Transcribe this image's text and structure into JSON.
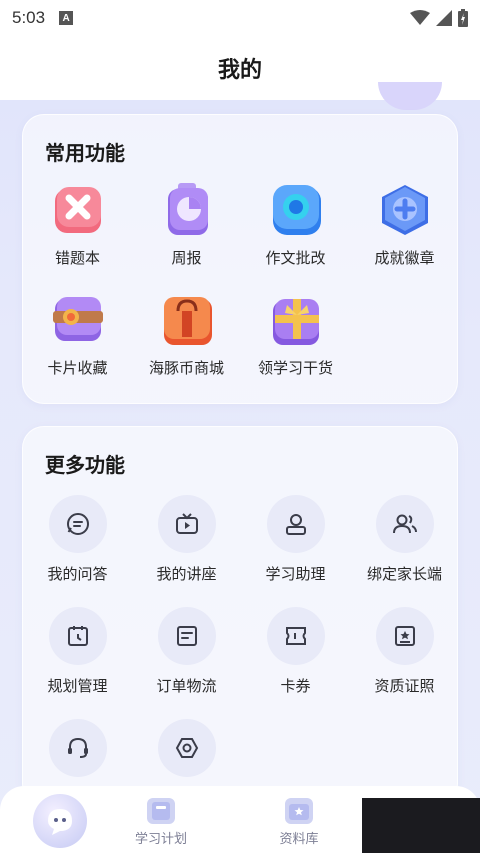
{
  "status": {
    "time": "5:03",
    "notif_letter": "A"
  },
  "header": {
    "title": "我的"
  },
  "common": {
    "title": "常用功能",
    "items": [
      {
        "label": "错题本",
        "icon": "wrong-book-icon",
        "color": "#f2566e"
      },
      {
        "label": "周报",
        "icon": "weekly-report-icon",
        "color": "#9a6ef0"
      },
      {
        "label": "作文批改",
        "icon": "essay-correction-icon",
        "color": "#3d8ef7"
      },
      {
        "label": "成就徽章",
        "icon": "achievement-badge-icon",
        "color": "#4f7cf3"
      },
      {
        "label": "卡片收藏",
        "icon": "card-collection-icon",
        "color": "#9b6ae8"
      },
      {
        "label": "海豚币商城",
        "icon": "coin-mall-icon",
        "color": "#f2703f"
      },
      {
        "label": "领学习干货",
        "icon": "gift-box-icon",
        "color": "#8d63ea"
      }
    ]
  },
  "more": {
    "title": "更多功能",
    "items": [
      {
        "label": "我的问答",
        "icon": "qa-chat-icon"
      },
      {
        "label": "我的讲座",
        "icon": "lecture-tv-icon"
      },
      {
        "label": "学习助理",
        "icon": "assistant-icon"
      },
      {
        "label": "绑定家长端",
        "icon": "bind-parent-icon"
      },
      {
        "label": "规划管理",
        "icon": "plan-calendar-icon"
      },
      {
        "label": "订单物流",
        "icon": "order-logistics-icon"
      },
      {
        "label": "卡券",
        "icon": "coupon-icon"
      },
      {
        "label": "资质证照",
        "icon": "certificate-icon"
      },
      {
        "label": "",
        "icon": "customer-service-icon"
      },
      {
        "label": "",
        "icon": "settings-icon"
      }
    ]
  },
  "nav": {
    "items": [
      {
        "label": "",
        "icon": "mascot-home-icon"
      },
      {
        "label": "学习计划",
        "icon": "study-plan-icon"
      },
      {
        "label": "资料库",
        "icon": "library-icon"
      }
    ]
  },
  "colors": {
    "icon_stroke": "#3b3d4a",
    "circle_bg": "#e8eaf8"
  }
}
